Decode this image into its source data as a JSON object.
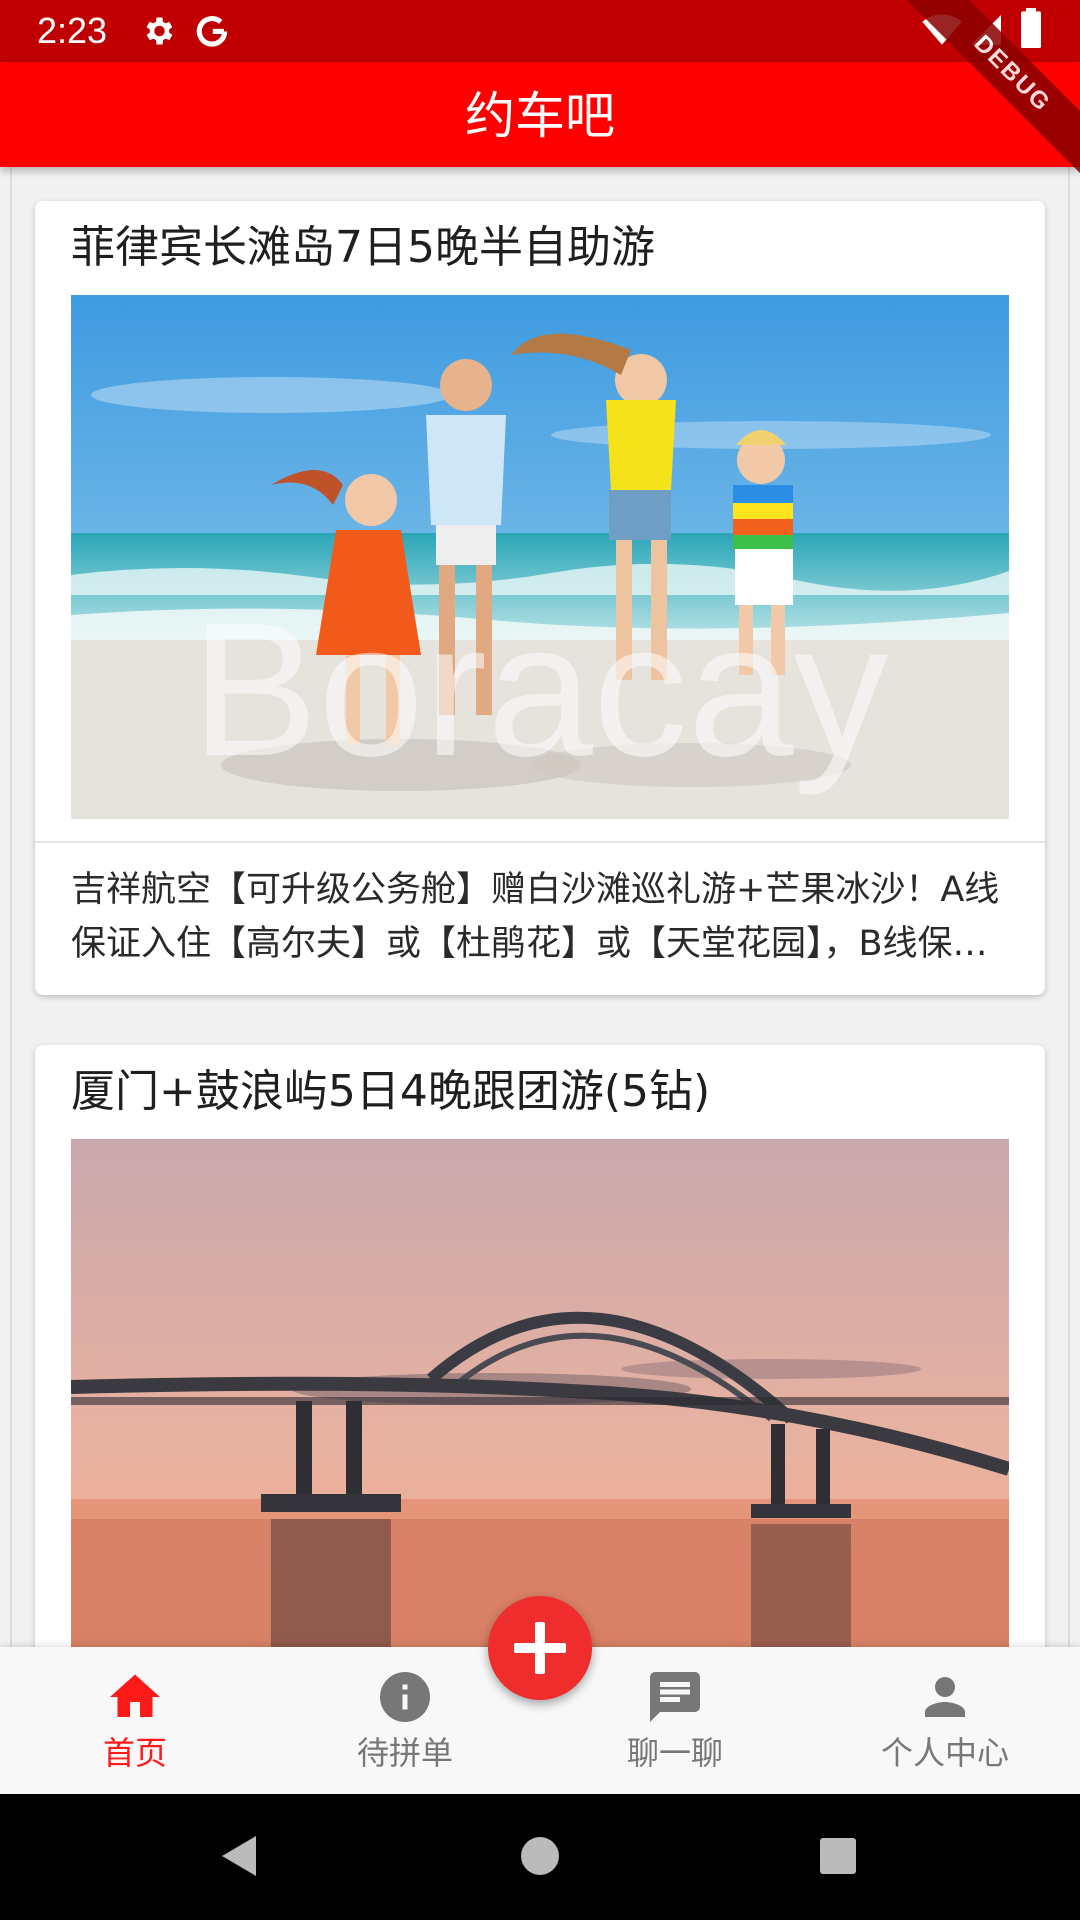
{
  "status_bar": {
    "time": "2:23",
    "icons": [
      "gear-icon",
      "google-icon",
      "wifi-icon",
      "signal-icon",
      "battery-icon"
    ],
    "background": "#c00000"
  },
  "debug_banner": "DEBUG",
  "app_bar": {
    "title": "约车吧",
    "background": "#ff0000"
  },
  "cards": [
    {
      "title": "菲律宾长滩岛7日5晚半自助游",
      "image_watermark": "Boracay",
      "description": "吉祥航空【可升级公务舱】赠白沙滩巡礼游+芒果冰沙！A线保证入住【高尔夫】或【杜鹃花】或【天堂花园】，B线保证入住【度假村】"
    },
    {
      "title": "厦门+鼓浪屿5日4晚跟团游(5钻)"
    }
  ],
  "bottom_nav": {
    "items": [
      {
        "label": "首页",
        "icon": "home-icon",
        "active": true
      },
      {
        "label": "待拼单",
        "icon": "info-icon",
        "active": false
      },
      {
        "label": "聊一聊",
        "icon": "chat-icon",
        "active": false
      },
      {
        "label": "个人中心",
        "icon": "person-icon",
        "active": false
      }
    ],
    "active_color": "#ff1a1a",
    "inactive_color": "#777777"
  },
  "fab": {
    "icon": "add-icon",
    "color": "#f02d2d"
  },
  "system_nav": {
    "buttons": [
      "back-icon",
      "home-circle-icon",
      "recents-icon"
    ]
  }
}
